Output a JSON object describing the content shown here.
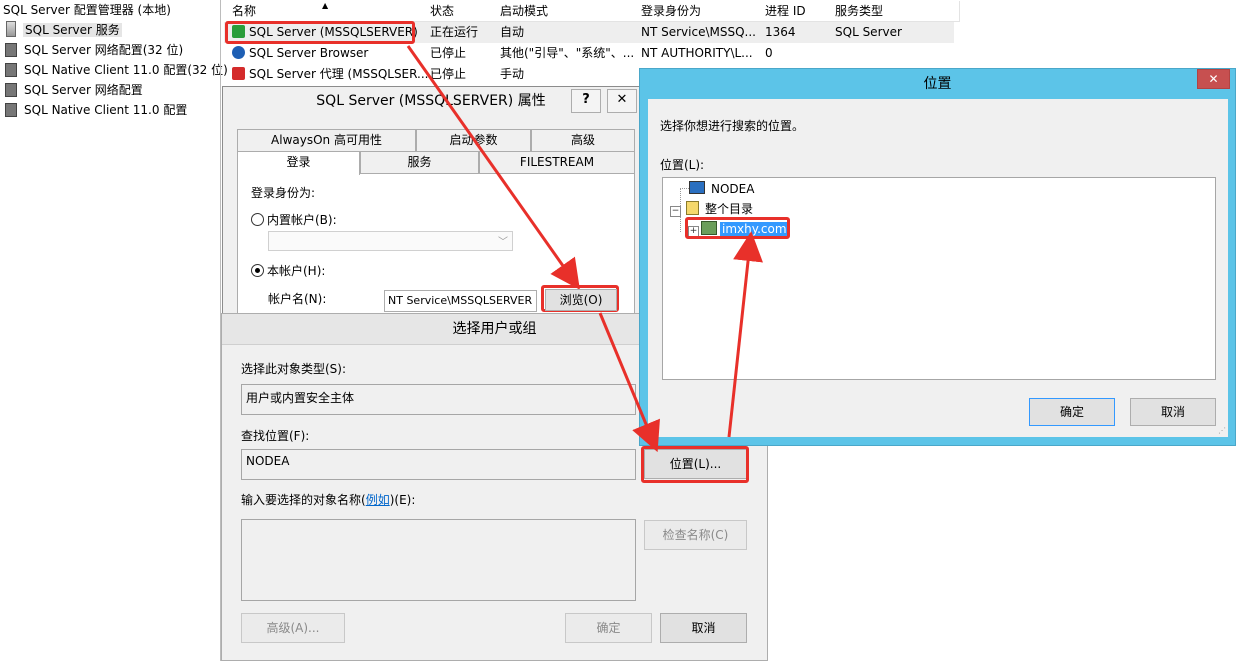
{
  "tree": {
    "items": [
      {
        "label": "SQL Server 配置管理器 (本地)"
      },
      {
        "label": "SQL Server 服务"
      },
      {
        "label": "SQL Server 网络配置(32 位)"
      },
      {
        "label": "SQL Native Client 11.0 配置(32 位)"
      },
      {
        "label": "SQL Server 网络配置"
      },
      {
        "label": "SQL Native Client 11.0 配置"
      }
    ]
  },
  "services": {
    "columns": [
      "名称",
      "状态",
      "启动模式",
      "登录身份为",
      "进程 ID",
      "服务类型"
    ],
    "rows": [
      {
        "name": "SQL Server (MSSQLSERVER)",
        "state": "正在运行",
        "start": "自动",
        "logon": "NT Service\\MSSQ...",
        "pid": "1364",
        "type": "SQL Server",
        "icon_color": "#2a9d3a"
      },
      {
        "name": "SQL Server Browser",
        "state": "已停止",
        "start": "其他(\"引导\"、\"系统\"、...",
        "logon": "NT AUTHORITY\\L...",
        "pid": "0",
        "type": "",
        "icon_color": "#1e5fb4"
      },
      {
        "name": "SQL Server 代理 (MSSQLSER...",
        "state": "已停止",
        "start": "手动",
        "logon": "",
        "pid": "",
        "type": "",
        "icon_color": "#d42b2b"
      }
    ]
  },
  "props_dialog": {
    "title": "SQL Server (MSSQLSERVER) 属性",
    "help": "?",
    "close": "✕",
    "tabs_top": [
      "AlwaysOn 高可用性",
      "启动参数",
      "高级"
    ],
    "tabs_bottom": [
      "登录",
      "服务",
      "FILESTREAM"
    ],
    "logon_as": "登录身份为:",
    "builtin_account": "内置帐户(B):",
    "this_account": "本帐户(H):",
    "account_name_label": "帐户名(N):",
    "account_name_value": "NT Service\\MSSQLSERVER",
    "browse_button": "浏览(O)"
  },
  "select_dialog": {
    "title": "选择用户或组",
    "object_type_label": "选择此对象类型(S):",
    "object_type_value": "用户或内置安全主体",
    "location_label": "查找位置(F):",
    "location_value": "NODEA",
    "location_button": "位置(L)...",
    "enter_names_prefix": "输入要选择的对象名称(",
    "enter_names_link": "例如",
    "enter_names_suffix": ")(E):",
    "check_names_button": "检查名称(C)",
    "advanced_button": "高级(A)...",
    "ok_button": "确定",
    "cancel_button": "取消"
  },
  "location_dialog": {
    "title": "位置",
    "close": "✕",
    "instruction": "选择你想进行搜索的位置。",
    "location_label": "位置(L):",
    "nodes": [
      "NODEA",
      "整个目录",
      "imxhy.com"
    ],
    "ok_button": "确定",
    "cancel_button": "取消"
  },
  "colors": {
    "accent": "#5cc4e8",
    "highlight": "#e8302a",
    "selection": "#3399ff"
  }
}
